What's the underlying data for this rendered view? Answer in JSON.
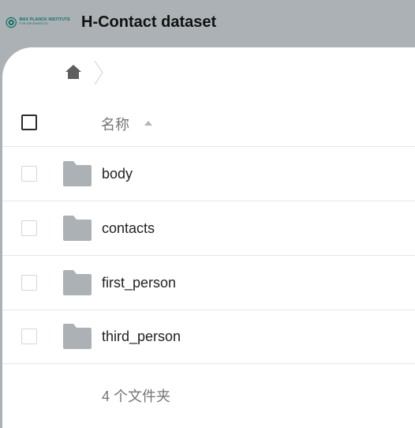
{
  "header": {
    "logo": {
      "line1": "MAX PLANCK INSTITUTE",
      "line2": "FOR INFORMATICS"
    },
    "title": "H-Contact dataset"
  },
  "breadcrumb": {
    "home_icon": "home-icon",
    "separator_icon": "chevron-right-icon"
  },
  "list": {
    "column_name": "名称",
    "sort": "ascending",
    "rows": [
      {
        "name": "body",
        "icon": "folder-icon"
      },
      {
        "name": "contacts",
        "icon": "folder-icon"
      },
      {
        "name": "first_person",
        "icon": "folder-icon"
      },
      {
        "name": "third_person",
        "icon": "folder-icon"
      }
    ],
    "summary": "4 个文件夹"
  },
  "colors": {
    "header_bg": "#abb1b5",
    "content_bg": "#ffffff",
    "folder": "#abb1b5",
    "brand": "#0e6f65"
  }
}
